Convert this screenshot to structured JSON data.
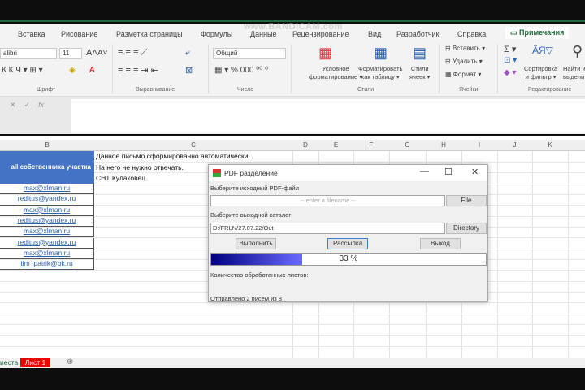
{
  "watermark": "www.BANDICAM.com",
  "ribbon_tabs": [
    "Вставка",
    "Рисование",
    "Разметка страницы",
    "Формулы",
    "Данные",
    "Рецензирование",
    "Вид",
    "Разработчик",
    "Справка"
  ],
  "notes_button": "Примечания",
  "font": {
    "name": "alibri",
    "size": "11",
    "group": "Шрифт"
  },
  "alignment_group": "Выравнивание",
  "number": {
    "format": "Общий",
    "group": "Число"
  },
  "styles": {
    "cond": "Условное",
    "cond2": "форматирование",
    "table": "Форматировать",
    "table2": "как таблицу",
    "cell": "Стили",
    "cell2": "ячеек",
    "group": "Стили"
  },
  "cells": {
    "insert": "Вставить",
    "delete": "Удалить",
    "format": "Формат",
    "group": "Ячейки"
  },
  "editing": {
    "sort": "Сортировка",
    "sort2": "и фильтр",
    "find": "Найти и",
    "find2": "выделить",
    "group": "Редактирование"
  },
  "formula": {
    "cancel": "✕",
    "ok": "✓",
    "fx": "fx"
  },
  "columns": [
    "B",
    "C",
    "D",
    "E",
    "F",
    "G",
    "H",
    "I",
    "J",
    "K"
  ],
  "header_cell": "ail собственника участка",
  "emails": [
    "max@xlman.ru",
    "reditus@yandex.ru",
    "max@xlman.ru",
    "reditus@yandex.ru",
    "max@xlman.ru",
    "reditus@yandex.ru",
    "max@xlman.ru",
    "tim_patrik@bk.ru"
  ],
  "c_lines": [
    "Данное письмо сформированно автоматически.",
    "На него не нужно отвечать.",
    "СНТ Кулаковец"
  ],
  "sheet_tabs": [
    "иеста",
    "Лист 1"
  ],
  "dialog": {
    "title": "PDF разделение",
    "src_label": "Выберите исходный PDF-файл",
    "src_placeholder": "-- enter a filename --",
    "file_btn": "File",
    "dir_label": "Выберите выходной каталог",
    "dir_value": "D:/FRLN/27.07.22/Out",
    "dir_btn": "Directory",
    "run_btn": "Выполнить",
    "mail_btn": "Рассылка",
    "exit_btn": "Выход",
    "progress_percent": 33,
    "progress_text": "33 %",
    "processed_label": "Количество обработанных листов:",
    "status": "Отправлено 2 писем из 8"
  }
}
